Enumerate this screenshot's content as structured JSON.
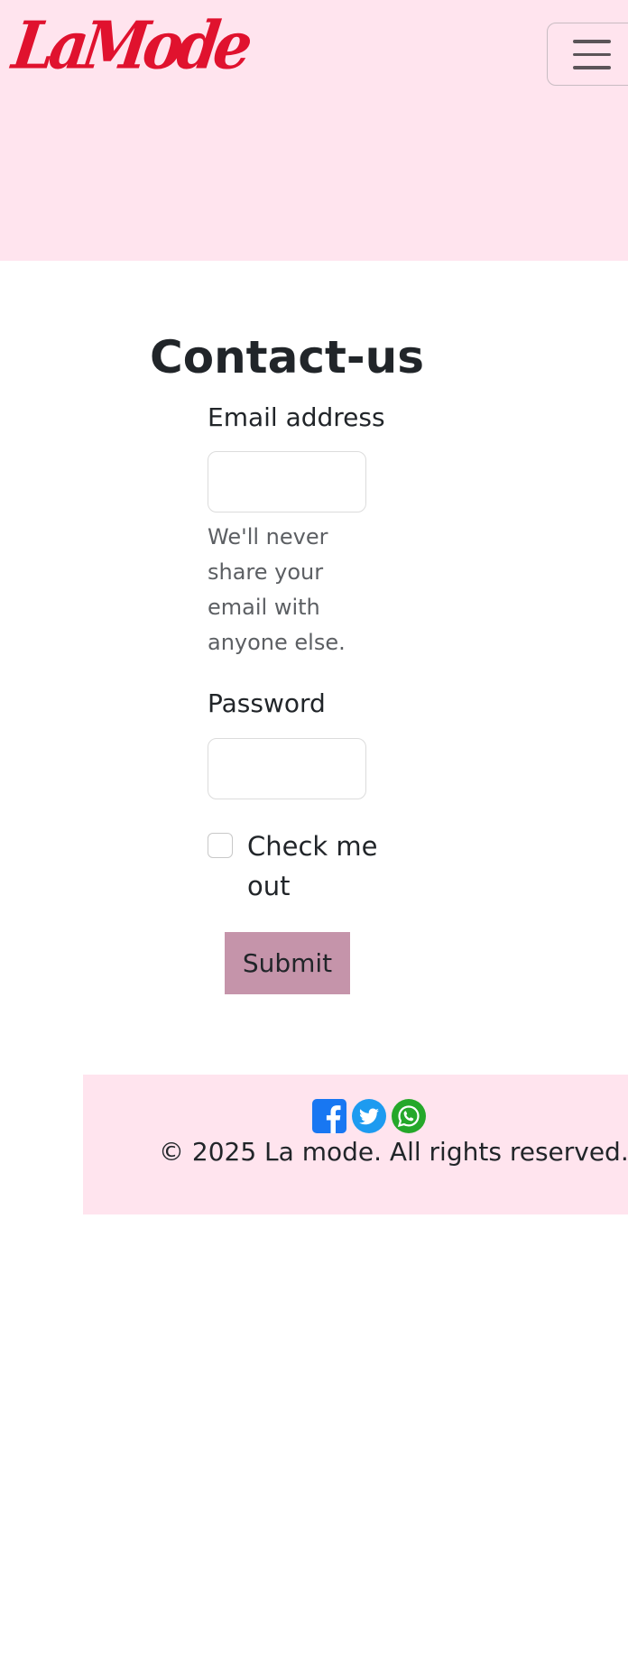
{
  "header": {
    "logo_text": "LaMode",
    "menu_icon": "hamburger-menu-icon"
  },
  "main": {
    "title": "Contact-us",
    "form": {
      "email_label": "Email address",
      "email_value": "",
      "email_help": "We'll never share your email with anyone else.",
      "password_label": "Password",
      "password_value": "",
      "checkbox_label": "Check me out",
      "checkbox_checked": false,
      "submit_label": "Submit"
    }
  },
  "footer": {
    "social_icons": [
      "facebook-icon",
      "twitter-icon",
      "whatsapp-icon"
    ],
    "copyright": "© 2025 La mode. All rights reserved."
  },
  "colors": {
    "header_bg": "#ffe4ee",
    "logo": "#e0122e",
    "submit_bg": "#c594aa",
    "facebook": "#1877f2",
    "twitter": "#1d9bf0",
    "whatsapp": "#25a82a"
  }
}
